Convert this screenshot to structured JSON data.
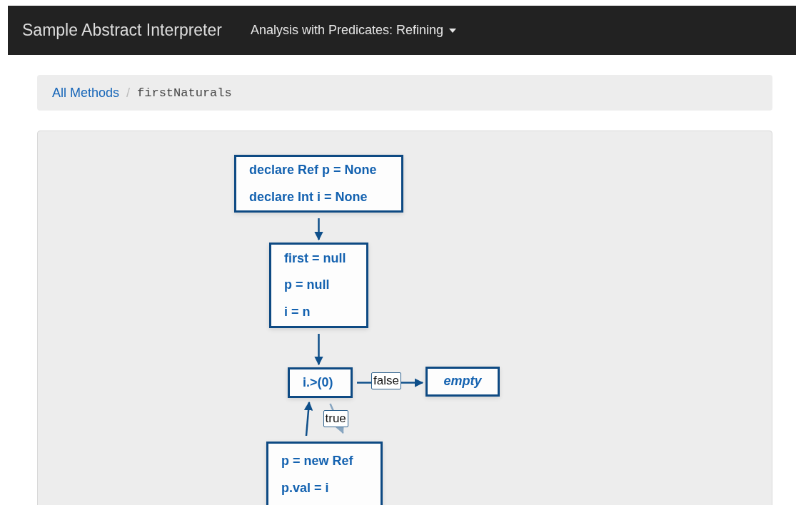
{
  "navbar": {
    "brand": "Sample Abstract Interpreter",
    "dropdown": "Analysis with Predicates: Refining"
  },
  "breadcrumb": [
    {
      "label": "All Methods",
      "kind": "link"
    },
    {
      "label": "/",
      "kind": "separator"
    },
    {
      "label": "firstNaturals",
      "kind": "current"
    }
  ],
  "graph": {
    "nodes": [
      {
        "kind": "statements",
        "lines": [
          "declare Ref p = None",
          "declare Int i = None"
        ]
      },
      {
        "kind": "statements",
        "lines": [
          "first = null",
          "p = null",
          "i = n"
        ]
      },
      {
        "kind": "statements",
        "lines": [
          "i.>(0)"
        ]
      },
      {
        "kind": "empty",
        "lines": [
          "empty"
        ]
      },
      {
        "kind": "statements",
        "lines": [
          "p = new Ref",
          "p.val = i"
        ]
      }
    ],
    "edge_labels": [
      "false",
      "true"
    ]
  }
}
